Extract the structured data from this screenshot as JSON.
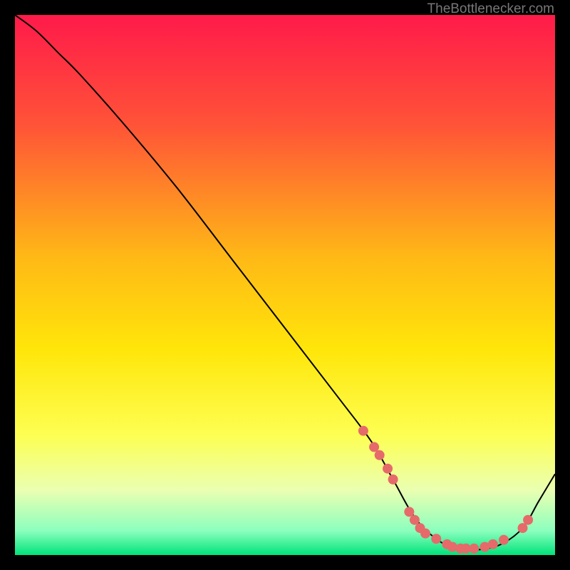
{
  "watermark": "TheBottlenecker.com",
  "chart_data": {
    "type": "line",
    "title": "",
    "xlabel": "",
    "ylabel": "",
    "xlim": [
      0,
      100
    ],
    "ylim": [
      0,
      100
    ],
    "background": {
      "kind": "vertical-gradient",
      "stops": [
        {
          "offset": 0.0,
          "color": "#ff1a4a"
        },
        {
          "offset": 0.2,
          "color": "#ff5238"
        },
        {
          "offset": 0.45,
          "color": "#ffb916"
        },
        {
          "offset": 0.62,
          "color": "#ffe60a"
        },
        {
          "offset": 0.78,
          "color": "#fdff54"
        },
        {
          "offset": 0.88,
          "color": "#eaffb1"
        },
        {
          "offset": 0.955,
          "color": "#8cffbe"
        },
        {
          "offset": 1.0,
          "color": "#00e37a"
        }
      ]
    },
    "series": [
      {
        "name": "bottleneck-curve",
        "x": [
          0,
          4,
          8,
          12,
          20,
          30,
          40,
          50,
          60,
          66,
          70,
          74,
          78,
          82,
          86,
          90,
          94,
          97,
          100
        ],
        "y": [
          100,
          97,
          93,
          89,
          80,
          68,
          55,
          42,
          29,
          21,
          14,
          7,
          3,
          1,
          1,
          2,
          5,
          10,
          15
        ]
      }
    ],
    "markers": [
      {
        "x": 64.5,
        "y": 23.0
      },
      {
        "x": 66.5,
        "y": 20.0
      },
      {
        "x": 67.5,
        "y": 18.5
      },
      {
        "x": 69.0,
        "y": 16.0
      },
      {
        "x": 70.0,
        "y": 14.0
      },
      {
        "x": 73.0,
        "y": 8.0
      },
      {
        "x": 74.0,
        "y": 6.5
      },
      {
        "x": 75.0,
        "y": 5.0
      },
      {
        "x": 76.0,
        "y": 4.0
      },
      {
        "x": 78.0,
        "y": 3.0
      },
      {
        "x": 80.0,
        "y": 2.0
      },
      {
        "x": 81.0,
        "y": 1.5
      },
      {
        "x": 82.5,
        "y": 1.2
      },
      {
        "x": 83.5,
        "y": 1.2
      },
      {
        "x": 85.0,
        "y": 1.2
      },
      {
        "x": 87.0,
        "y": 1.5
      },
      {
        "x": 88.5,
        "y": 2.0
      },
      {
        "x": 90.5,
        "y": 2.8
      },
      {
        "x": 94.0,
        "y": 5.0
      },
      {
        "x": 95.0,
        "y": 6.5
      }
    ],
    "marker_style": {
      "fill": "#e66a6a",
      "r": 7
    }
  }
}
